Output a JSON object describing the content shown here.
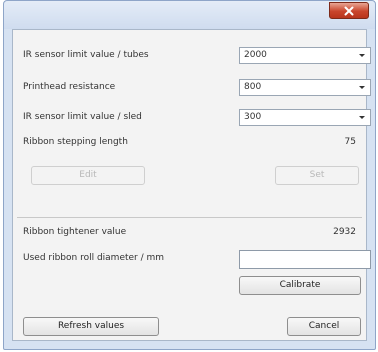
{
  "window": {
    "close_icon": "close-icon"
  },
  "settings": {
    "ir_sensor_tubes": {
      "label": "IR sensor limit value / tubes",
      "value": "2000"
    },
    "printhead_resistance": {
      "label": "Printhead resistance",
      "value": "800"
    },
    "ir_sensor_sled": {
      "label": "IR sensor limit value / sled",
      "value": "300"
    },
    "ribbon_stepping": {
      "label": "Ribbon stepping length",
      "value": "75"
    }
  },
  "buttons": {
    "edit": "Edit",
    "set": "Set",
    "calibrate": "Calibrate",
    "refresh": "Refresh values",
    "cancel": "Cancel"
  },
  "calibration": {
    "tightener": {
      "label": "Ribbon tightener value",
      "value": "2932"
    },
    "diameter": {
      "label": "Used ribbon roll diameter / mm",
      "value": ""
    }
  }
}
